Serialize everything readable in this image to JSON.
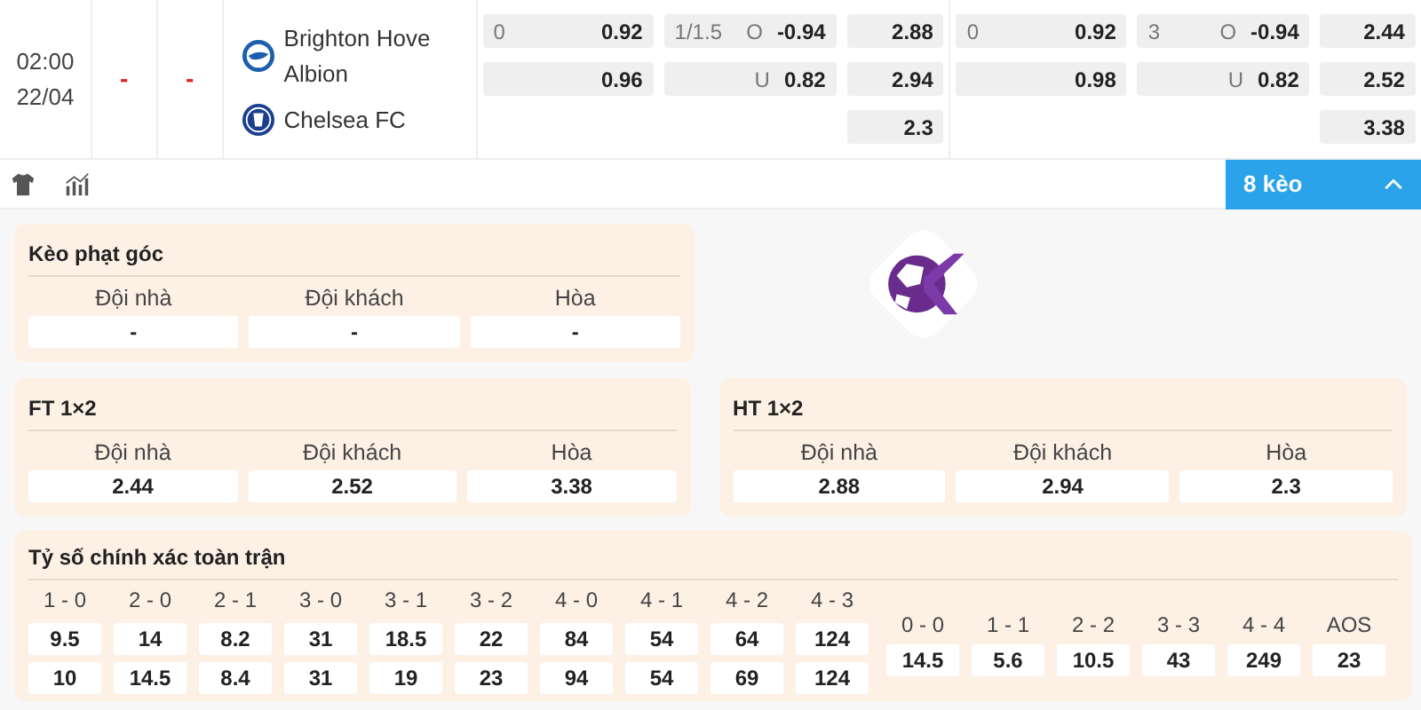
{
  "match": {
    "time": "02:00",
    "date": "22/04",
    "score_home": "-",
    "score_away": "-",
    "home": {
      "name": "Brighton Hove Albion"
    },
    "away": {
      "name": "Chelsea FC"
    }
  },
  "odds_sections": [
    {
      "handicap": [
        {
          "line": "0",
          "value": "0.92"
        },
        {
          "value": "0.96"
        }
      ],
      "over_under": [
        {
          "line": "1/1.5",
          "side": "O",
          "value": "-0.94"
        },
        {
          "side": "U",
          "value": "0.82"
        }
      ],
      "one_x_two": [
        "2.88",
        "2.94",
        "2.3"
      ]
    },
    {
      "handicap": [
        {
          "line": "0",
          "value": "0.92"
        },
        {
          "value": "0.98"
        }
      ],
      "over_under": [
        {
          "line": "3",
          "side": "O",
          "value": "-0.94"
        },
        {
          "side": "U",
          "value": "0.82"
        }
      ],
      "one_x_two": [
        "2.44",
        "2.52",
        "3.38"
      ]
    }
  ],
  "more_button": {
    "label": "8 kèo",
    "expanded": true
  },
  "markets": [
    {
      "title": "Kèo phạt góc",
      "outcomes": [
        {
          "label": "Đội nhà",
          "value": "-"
        },
        {
          "label": "Đội khách",
          "value": "-"
        },
        {
          "label": "Hòa",
          "value": "-"
        }
      ]
    },
    {
      "title": "FT 1×2",
      "outcomes": [
        {
          "label": "Đội nhà",
          "value": "2.44"
        },
        {
          "label": "Đội khách",
          "value": "2.52"
        },
        {
          "label": "Hòa",
          "value": "3.38"
        }
      ]
    },
    {
      "title": "HT 1×2",
      "outcomes": [
        {
          "label": "Đội nhà",
          "value": "2.88"
        },
        {
          "label": "Đội khách",
          "value": "2.94"
        },
        {
          "label": "Hòa",
          "value": "2.3"
        }
      ]
    }
  ],
  "exact_score": {
    "title": "Tỷ số chính xác toàn trận",
    "results": [
      {
        "label": "1 - 0",
        "values": [
          "9.5",
          "10"
        ]
      },
      {
        "label": "2 - 0",
        "values": [
          "14",
          "14.5"
        ]
      },
      {
        "label": "2 - 1",
        "values": [
          "8.2",
          "8.4"
        ]
      },
      {
        "label": "3 - 0",
        "values": [
          "31",
          "31"
        ]
      },
      {
        "label": "3 - 1",
        "values": [
          "18.5",
          "19"
        ]
      },
      {
        "label": "3 - 2",
        "values": [
          "22",
          "23"
        ]
      },
      {
        "label": "4 - 0",
        "values": [
          "84",
          "94"
        ]
      },
      {
        "label": "4 - 1",
        "values": [
          "54",
          "54"
        ]
      },
      {
        "label": "4 - 2",
        "values": [
          "64",
          "69"
        ]
      },
      {
        "label": "4 - 3",
        "values": [
          "124",
          "124"
        ]
      }
    ],
    "draws": [
      {
        "label": "0 - 0",
        "value": "14.5"
      },
      {
        "label": "1 - 1",
        "value": "5.6"
      },
      {
        "label": "2 - 2",
        "value": "10.5"
      },
      {
        "label": "3 - 3",
        "value": "43"
      },
      {
        "label": "4 - 4",
        "value": "249"
      },
      {
        "label": "AOS",
        "value": "23"
      }
    ]
  }
}
